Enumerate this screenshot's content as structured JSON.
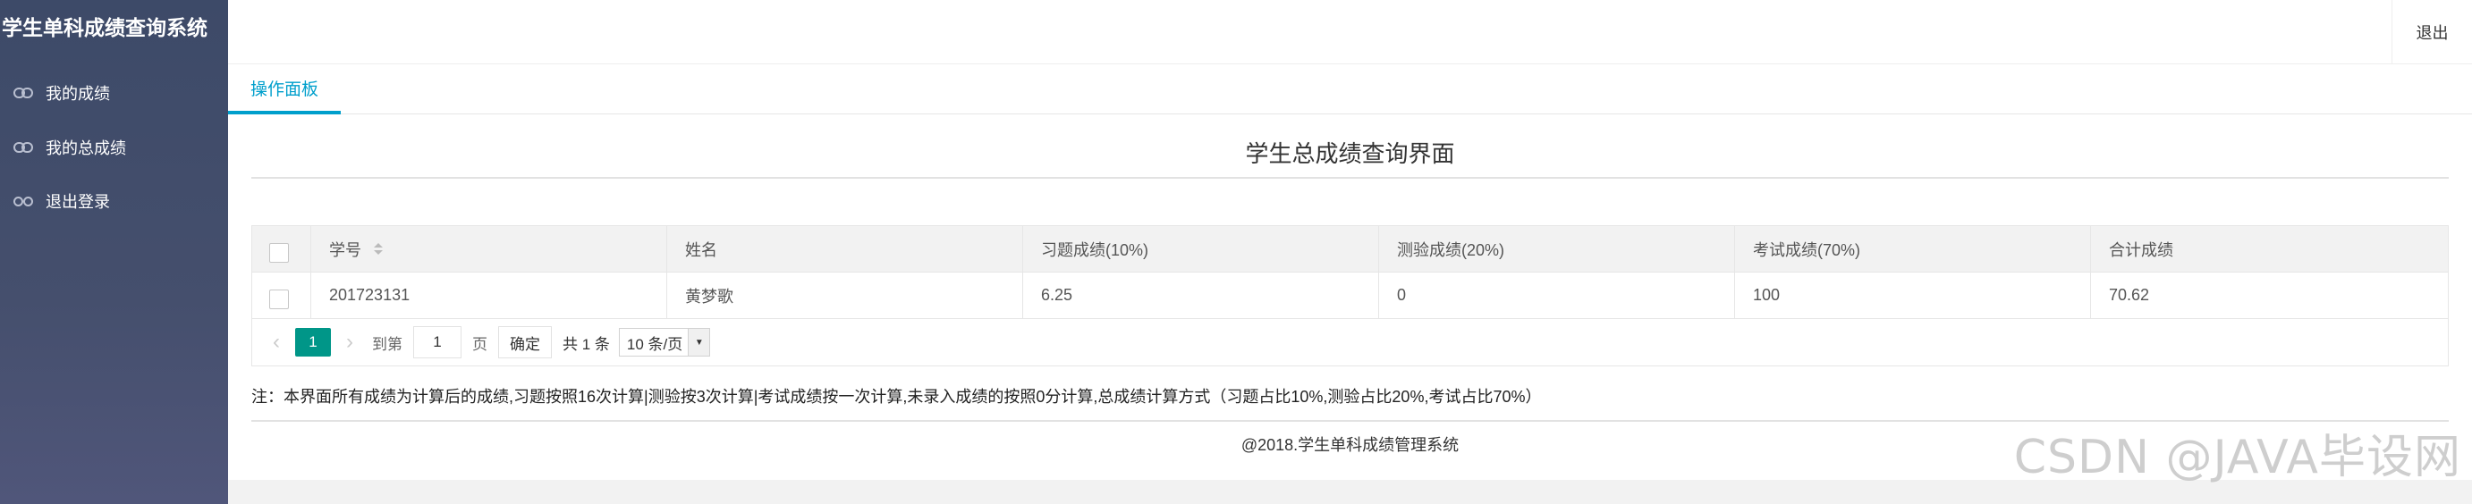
{
  "app": {
    "title": "学生单科成绩查询系统"
  },
  "sidebar": {
    "items": [
      {
        "label": "我的成绩",
        "icon": "link-icon"
      },
      {
        "label": "我的总成绩",
        "icon": "link-icon"
      },
      {
        "label": "退出登录",
        "icon": "link-icon"
      }
    ]
  },
  "topbar": {
    "logout_label": "退出"
  },
  "tabs": [
    {
      "label": "操作面板",
      "active": true
    }
  ],
  "page": {
    "title": "学生总成绩查询界面"
  },
  "table": {
    "columns": [
      "学号",
      "姓名",
      "习题成绩(10%)",
      "测验成绩(20%)",
      "考试成绩(70%)",
      "合计成绩"
    ],
    "rows": [
      [
        "201723131",
        "黄梦歌",
        "6.25",
        "0",
        "100",
        "70.62"
      ]
    ]
  },
  "pager": {
    "current_page": "1",
    "goto_label": "到第",
    "goto_value": "1",
    "page_unit": "页",
    "confirm_label": "确定",
    "total_label": "共 1 条",
    "page_size": "10 条/页"
  },
  "note": "注：本界面所有成绩为计算后的成绩,习题按照16次计算|测验按3次计算|考试成绩按一次计算,未录入成绩的按照0分计算,总成绩计算方式（习题占比10%,测验占比20%,考试占比70%）",
  "footer": "@2018.学生单科成绩管理系统",
  "watermark": "CSDN @JAVA毕设网",
  "colors": {
    "sidebar_bg": "#3d4a68",
    "accent": "#009fcc",
    "page_active": "#009688"
  }
}
